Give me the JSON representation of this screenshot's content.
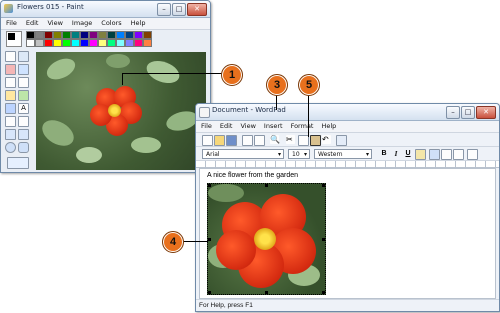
{
  "paint": {
    "title": "Flowers 015 - Paint",
    "menu": [
      "File",
      "Edit",
      "View",
      "Image",
      "Colors",
      "Help"
    ],
    "palette": [
      "#000000",
      "#808080",
      "#800000",
      "#808000",
      "#008000",
      "#008080",
      "#000080",
      "#800080",
      "#808040",
      "#004040",
      "#0080ff",
      "#004080",
      "#8000ff",
      "#804000",
      "#ffffff",
      "#c0c0c0",
      "#ff0000",
      "#ffff00",
      "#00ff00",
      "#00ffff",
      "#0000ff",
      "#ff00ff",
      "#ffff80",
      "#00ff80",
      "#80ffff",
      "#8080ff",
      "#ff0080",
      "#ff8040"
    ]
  },
  "wordpad": {
    "title": "Document - WordPad",
    "menu": [
      "File",
      "Edit",
      "View",
      "Insert",
      "Format",
      "Help"
    ],
    "font_name": "Arial",
    "font_size": "10",
    "script": "Western",
    "format_buttons": [
      "B",
      "I",
      "U"
    ],
    "document_text": "A nice flower from the garden",
    "status": "For Help, press F1"
  },
  "callouts": [
    "1",
    "3",
    "5",
    "4"
  ],
  "window_buttons": {
    "minimize": "–",
    "maximize": "□",
    "close": "✕"
  }
}
